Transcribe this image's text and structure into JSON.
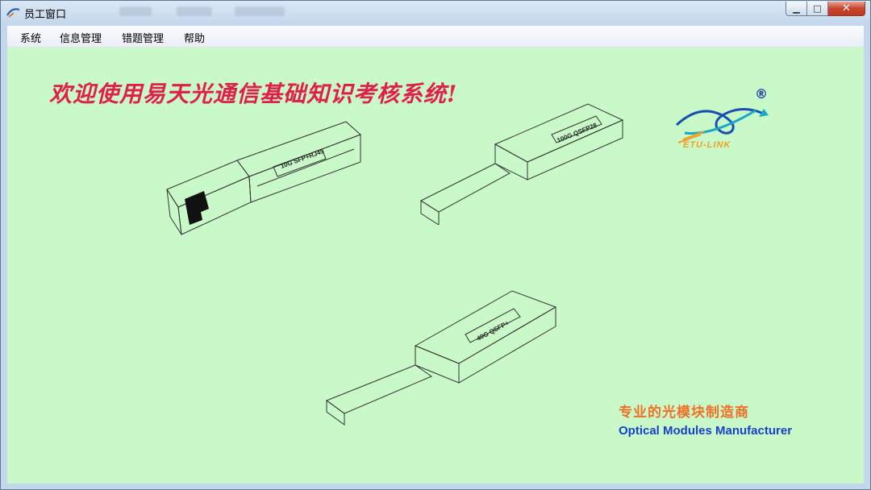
{
  "window": {
    "title": "员工窗口"
  },
  "menu": {
    "items": [
      {
        "label": "系统"
      },
      {
        "label": "信息管理"
      },
      {
        "label": "错题管理"
      },
      {
        "label": "帮助"
      }
    ]
  },
  "main": {
    "welcome": "欢迎使用易天光通信基础知识考核系统!",
    "logo_text": "ETU-LINK",
    "logo_reg": "®",
    "tagline_cn": "专业的光模块制造商",
    "tagline_en": "Optical Modules Manufacturer",
    "modules": [
      {
        "label": "10G SFP+RJ45"
      },
      {
        "label": "100G QSFP28"
      },
      {
        "label": "40G QSFP+"
      }
    ]
  },
  "colors": {
    "client_bg": "#c9f8c9",
    "welcome": "#e0204a",
    "tagline_cn": "#f07028",
    "tagline_en": "#1840d0"
  },
  "icons": [
    "app-icon",
    "minimize-icon",
    "maximize-icon",
    "close-icon"
  ]
}
